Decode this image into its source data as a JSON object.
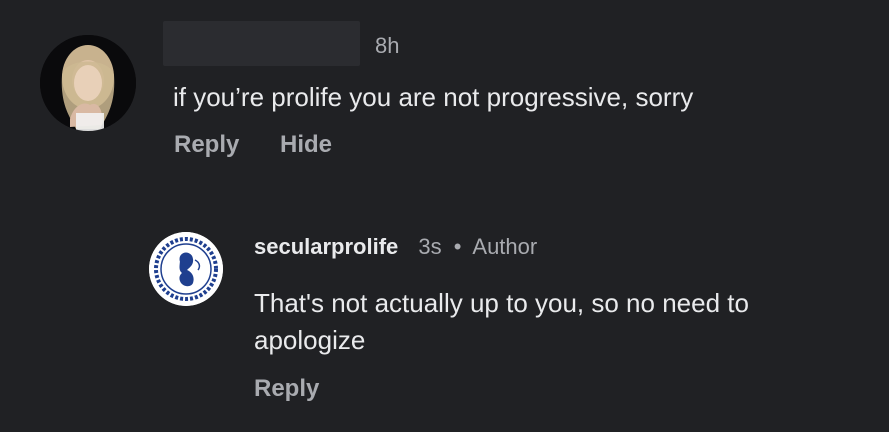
{
  "parent_comment": {
    "username": "",
    "time": "8h",
    "text": "if you’re prolife you are not progressive, sorry",
    "reply_label": "Reply",
    "hide_label": "Hide"
  },
  "reply_comment": {
    "username": "secularprolife",
    "time": "3s",
    "author_badge": "Author",
    "text": "That's not actually up to you, so no need to apologize",
    "reply_label": "Reply"
  },
  "colors": {
    "background": "#202124",
    "text": "#e9eaec",
    "muted": "#a9abb0",
    "logo_blue": "#1f3f8f"
  },
  "icons": {
    "parent_avatar": "user-avatar-photo",
    "reply_avatar": "secular-prolife-logo"
  }
}
